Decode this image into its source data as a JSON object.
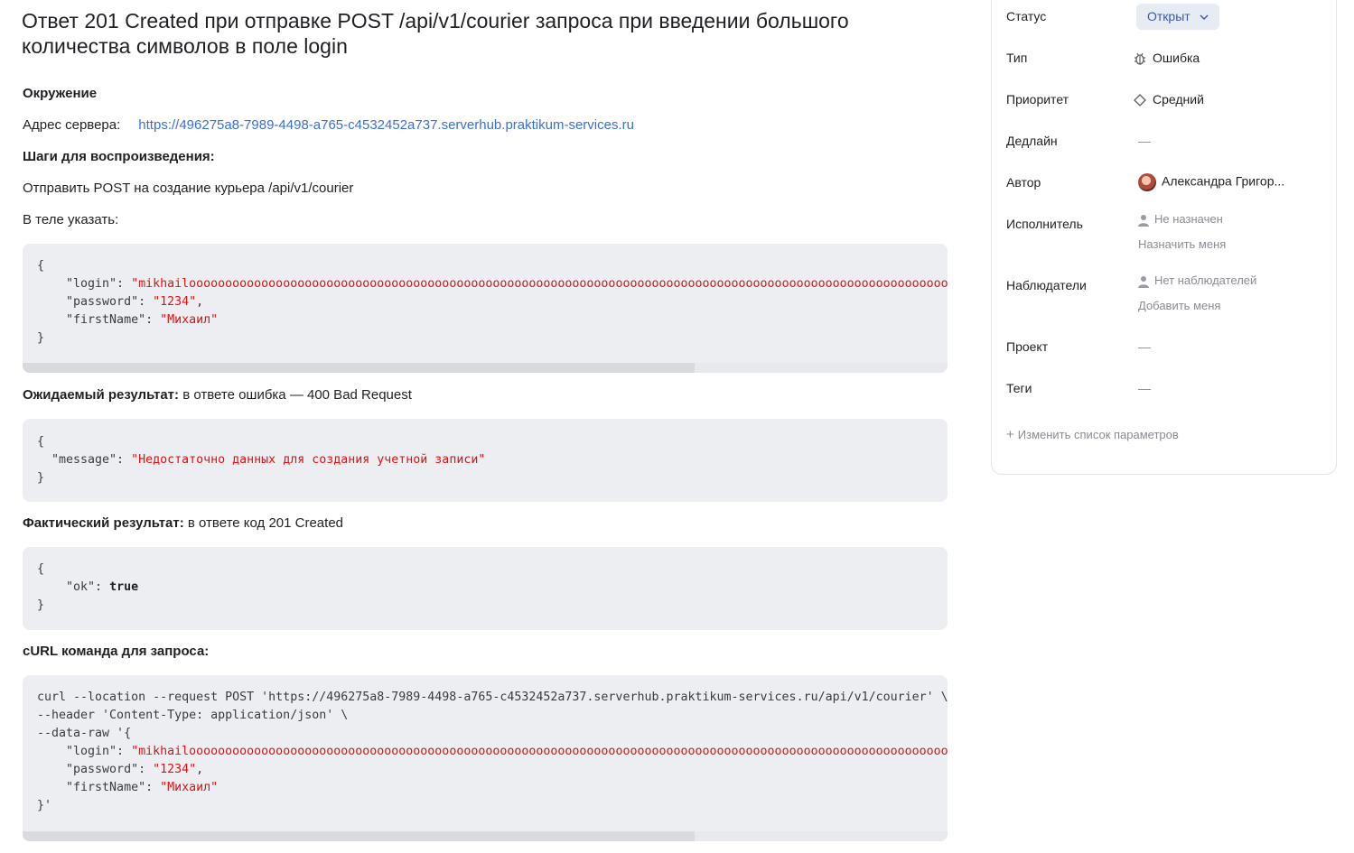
{
  "issue": {
    "title": "Ответ 201 Created при отправке POST /api/v1/courier запроса при введении большого количества символов в поле login"
  },
  "description": {
    "env_heading": "Окружение",
    "server_label": "Адрес сервера:",
    "server_url": "https://496275a8-7989-4498-a765-c4532452a737.serverhub.praktikum-services.ru",
    "steps_heading": "Шаги для воспроизведения:",
    "step1": "Отправить POST на создание курьера /api/v1/courier",
    "step2": "В теле указать:",
    "body_code": {
      "open": "{",
      "login_key": "    \"login\": ",
      "login_val": "\"mikhailoooooooooooooooooooooooooooooooooooooooooooooooooooooooooooooooooooooooooooooooooooooooooooooooooooooooooooo",
      "password_key": "    \"password\": ",
      "password_val": "\"1234\"",
      "firstname_key": "    \"firstName\": ",
      "firstname_val": "\"Михаил\"",
      "close": "}"
    },
    "expected_label": "Ожидаемый результат:",
    "expected_text": " в ответе ошибка — 400 Bad Request",
    "expected_code": {
      "open": "{",
      "message_key": "  \"message\": ",
      "message_val": "\"Недостаточно данных для создания учетной записи\"",
      "close": "}"
    },
    "actual_label": "Фактический результат:",
    "actual_text": " в ответе код 201 Created",
    "actual_code": {
      "open": "{",
      "ok_key": "    \"ok\": ",
      "ok_val": "true",
      "close": "}"
    },
    "curl_heading": "cURL команда для запроса:",
    "curl_code": {
      "line1": "curl --location --request POST 'https://496275a8-7989-4498-a765-c4532452a737.serverhub.praktikum-services.ru/api/v1/courier' \\",
      "line2": "--header 'Content-Type: application/json' \\",
      "line3": "--data-raw '{",
      "login_key": "    \"login\": ",
      "login_val": "\"mikhailoooooooooooooooooooooooooooooooooooooooooooooooooooooooooooooooooooooooooooooooooooooooooooooooooooooooooooooo",
      "password_key": "    \"password\": ",
      "password_val": "\"1234\"",
      "firstname_key": "    \"firstName\": ",
      "firstname_val": "\"Михаил\"",
      "close": "}'"
    }
  },
  "sidebar": {
    "status_label": "Статус",
    "status_value": "Открыт",
    "type_label": "Тип",
    "type_value": "Ошибка",
    "priority_label": "Приоритет",
    "priority_value": "Средний",
    "deadline_label": "Дедлайн",
    "deadline_value": "—",
    "author_label": "Автор",
    "author_value": "Александра Григор...",
    "assignee_label": "Исполнитель",
    "assignee_value": "Не назначен",
    "assign_me": "Назначить меня",
    "watchers_label": "Наблюдатели",
    "watchers_value": "Нет наблюдателей",
    "add_me": "Добавить меня",
    "project_label": "Проект",
    "project_value": "—",
    "tags_label": "Теги",
    "tags_value": "—",
    "edit_params": "Изменить список параметров"
  },
  "colors": {
    "accent_link": "#3b6fd3",
    "code_string": "#e01010",
    "code_bg": "#edeef1"
  }
}
